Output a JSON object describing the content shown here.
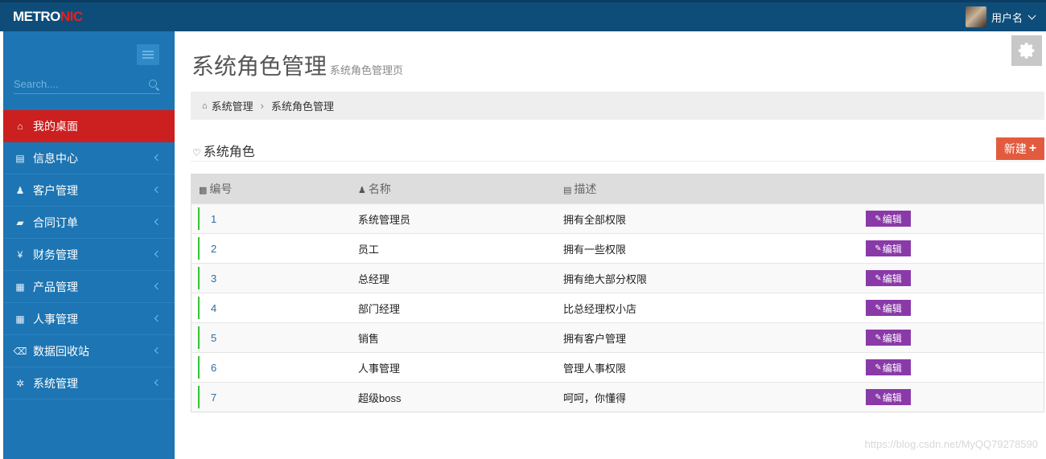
{
  "brand": {
    "left": "METRO",
    "right": "NIC"
  },
  "user": {
    "name": "用户名"
  },
  "sidebar": {
    "search_placeholder": "Search....",
    "items": [
      {
        "label": "我的桌面",
        "icon": "⌂",
        "active": true
      },
      {
        "label": "信息中心",
        "icon": "▤"
      },
      {
        "label": "客户管理",
        "icon": "♟"
      },
      {
        "label": "合同订单",
        "icon": "▰"
      },
      {
        "label": "财务管理",
        "icon": "¥"
      },
      {
        "label": "产品管理",
        "icon": "▦"
      },
      {
        "label": "人事管理",
        "icon": "▦"
      },
      {
        "label": "数据回收站",
        "icon": "⌫"
      },
      {
        "label": "系统管理",
        "icon": "✲"
      }
    ]
  },
  "page": {
    "title": "系统角色管理",
    "subtitle": "系统角色管理页"
  },
  "breadcrumb": {
    "items": [
      "系统管理",
      "系统角色管理"
    ]
  },
  "section": {
    "title": "系统角色",
    "new_label": "新建"
  },
  "table": {
    "headers": [
      "编号",
      "名称",
      "描述"
    ],
    "edit_label": "编辑",
    "rows": [
      {
        "id": "1",
        "name": "系统管理员",
        "desc": "拥有全部权限"
      },
      {
        "id": "2",
        "name": "员工",
        "desc": "拥有一些权限"
      },
      {
        "id": "3",
        "name": "总经理",
        "desc": "拥有绝大部分权限"
      },
      {
        "id": "4",
        "name": "部门经理",
        "desc": "比总经理权小店"
      },
      {
        "id": "5",
        "name": "销售",
        "desc": "拥有客户管理"
      },
      {
        "id": "6",
        "name": "人事管理",
        "desc": "管理人事权限"
      },
      {
        "id": "7",
        "name": "超级boss",
        "desc": "呵呵，你懂得"
      }
    ]
  },
  "watermark": "https://blog.csdn.net/MyQQ79278590",
  "colors": {
    "topbar": "#0e4d7a",
    "sidebar": "#1d75b3",
    "active": "#cc1f1f",
    "new_button": "#e35b3e",
    "edit_button": "#8a3aa8"
  }
}
